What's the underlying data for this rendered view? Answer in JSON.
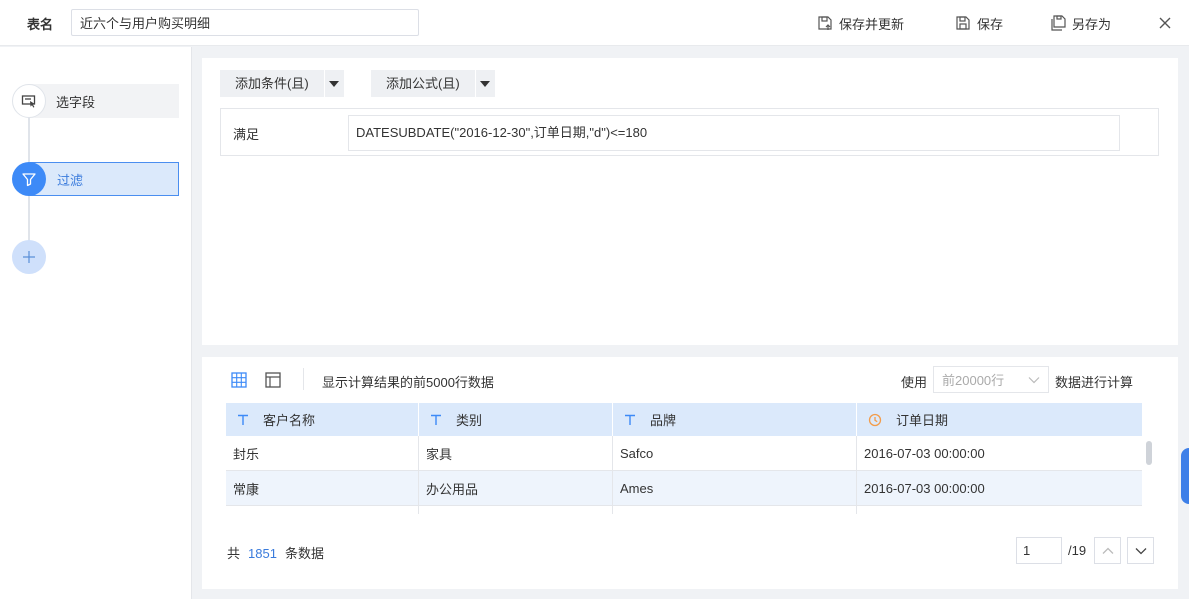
{
  "header": {
    "table_name_label": "表名",
    "table_name_value": "近六个与用户购买明细",
    "save_update_label": "保存并更新",
    "save_label": "保存",
    "save_as_label": "另存为"
  },
  "steps": [
    {
      "label": "选字段",
      "icon": "select-field-icon"
    },
    {
      "label": "过滤",
      "icon": "filter-icon",
      "active": true
    }
  ],
  "filter": {
    "add_condition_label": "添加条件(且)",
    "add_formula_label": "添加公式(且)",
    "condition_label": "满足",
    "formula": "DATESUBDATE(\"2016-12-30\",订单日期,\"d\")<=180"
  },
  "preview": {
    "description": "显示计算结果的前5000行数据",
    "use_label": "使用",
    "rows_select_value": "前20000行",
    "calc_label": "数据进行计算",
    "columns": [
      {
        "label": "客户名称",
        "icon": "text-type-icon"
      },
      {
        "label": "类别",
        "icon": "text-type-icon"
      },
      {
        "label": "品牌",
        "icon": "text-type-icon"
      },
      {
        "label": "订单日期",
        "icon": "clock-icon"
      }
    ],
    "rows": [
      [
        "封乐",
        "家具",
        "Safco",
        "2016-07-03 00:00:00"
      ],
      [
        "常康",
        "办公用品",
        "Ames",
        "2016-07-03 00:00:00"
      ]
    ],
    "total_prefix": "共",
    "total_count": "1851",
    "total_suffix": "条数据",
    "page_current": "1",
    "page_total": "/19"
  },
  "colors": {
    "accent": "#3d8af7",
    "header_row": "#dbe9fb",
    "date_icon": "#f39c4a"
  }
}
